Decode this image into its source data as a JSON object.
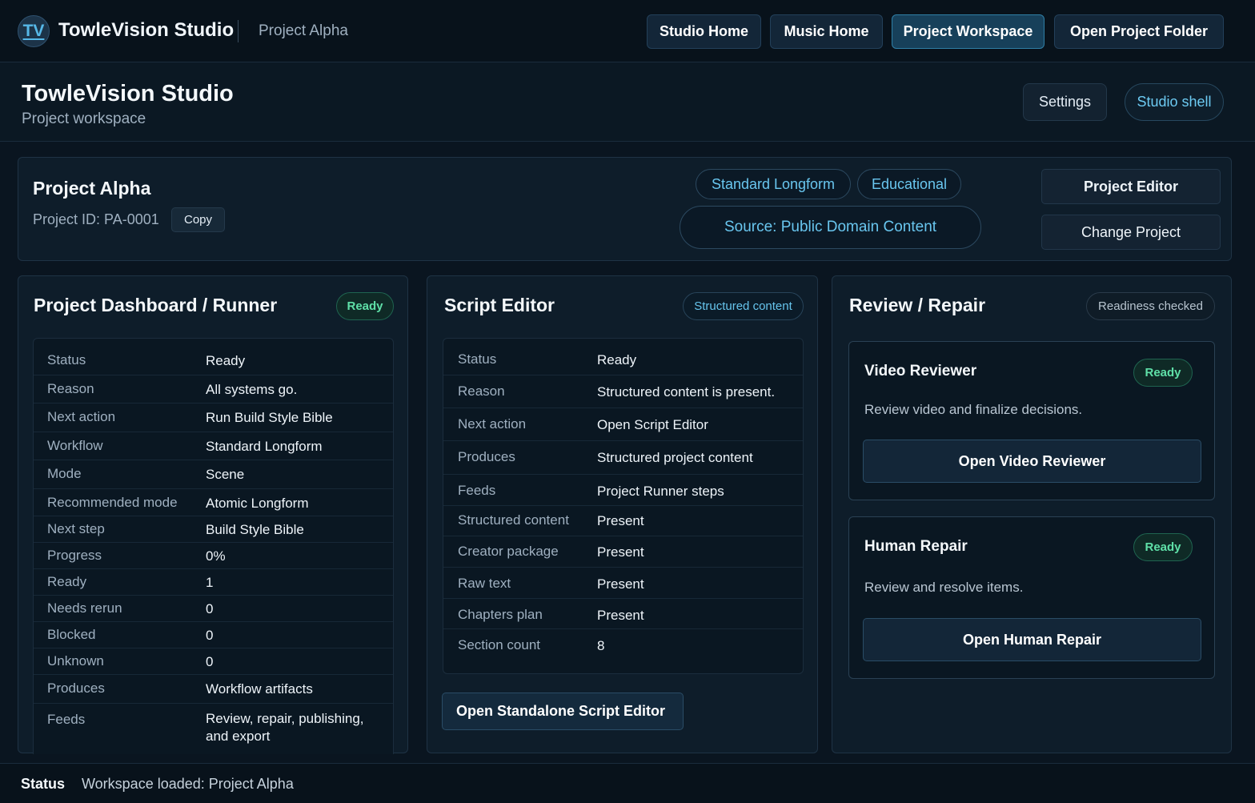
{
  "topbar": {
    "logo": "TV",
    "brand": "TowleVision Studio",
    "project": "Project Alpha",
    "nav": [
      "Studio Home",
      "Music Home",
      "Project Workspace",
      "Open Project Folder"
    ]
  },
  "header": {
    "title": "TowleVision Studio",
    "subtitle": "Project workspace",
    "settings": "Settings",
    "shell": "Studio shell"
  },
  "project": {
    "name": "Project Alpha",
    "id_text": "Project ID: PA-0001",
    "copy": "Copy",
    "chips": [
      "Standard Longform",
      "Educational"
    ],
    "source": "Source: Public Domain Content",
    "editor_btn": "Project Editor",
    "change_btn": "Change Project"
  },
  "dashboard": {
    "title": "Project Dashboard / Runner",
    "badge": "Ready",
    "rows": [
      {
        "k": "Status",
        "v": "Ready"
      },
      {
        "k": "Reason",
        "v": "All systems go."
      },
      {
        "k": "Next action",
        "v": "Run Build Style Bible"
      },
      {
        "k": "Workflow",
        "v": "Standard Longform"
      },
      {
        "k": "Mode",
        "v": "Scene"
      },
      {
        "k": "Recommended mode",
        "v": "Atomic Longform"
      },
      {
        "k": "Next step",
        "v": "Build Style Bible"
      },
      {
        "k": "Progress",
        "v": "0%"
      },
      {
        "k": "Ready",
        "v": "1"
      },
      {
        "k": "Needs rerun",
        "v": "0"
      },
      {
        "k": "Blocked",
        "v": "0"
      },
      {
        "k": "Unknown",
        "v": "0"
      },
      {
        "k": "Produces",
        "v": "Workflow artifacts"
      },
      {
        "k": "Feeds",
        "v": "Review, repair, publishing, and export"
      }
    ]
  },
  "script": {
    "title": "Script Editor",
    "badge": "Structured content",
    "rows": [
      {
        "k": "Status",
        "v": "Ready"
      },
      {
        "k": "Reason",
        "v": "Structured content is present."
      },
      {
        "k": "Next action",
        "v": "Open Script Editor"
      },
      {
        "k": "Produces",
        "v": "Structured project content"
      },
      {
        "k": "Feeds",
        "v": "Project Runner steps"
      },
      {
        "k": "Structured content",
        "v": "Present"
      },
      {
        "k": "Creator package",
        "v": "Present"
      },
      {
        "k": "Raw text",
        "v": "Present"
      },
      {
        "k": "Chapters plan",
        "v": "Present"
      },
      {
        "k": "Section count",
        "v": "8"
      }
    ],
    "open_btn": "Open Standalone Script Editor"
  },
  "review": {
    "title": "Review / Repair",
    "badge": "Readiness checked",
    "cards": [
      {
        "title": "Video Reviewer",
        "badge": "Ready",
        "desc": "Review video and finalize decisions.",
        "button": "Open Video Reviewer"
      },
      {
        "title": "Human Repair",
        "badge": "Ready",
        "desc": "Review and resolve items.",
        "button": "Open Human Repair"
      }
    ]
  },
  "status": {
    "label": "Status",
    "text": "Workspace loaded: Project Alpha"
  }
}
